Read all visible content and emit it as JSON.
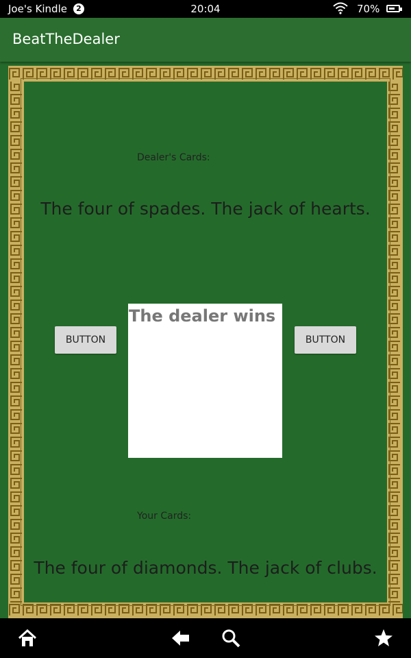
{
  "status_bar": {
    "device_name": "Joe's Kindle",
    "notification_count": "2",
    "time": "20:04",
    "battery_percent": "70%",
    "battery_level": 0.7
  },
  "app_bar": {
    "title": "BeatTheDealer"
  },
  "dealer": {
    "label": "Dealer's Cards:",
    "cards": "The four of spades. The jack of hearts."
  },
  "controls": {
    "left_button": "BUTTON",
    "right_button": "BUTTON"
  },
  "result": {
    "text": "The dealer wins"
  },
  "player": {
    "label": "Your Cards:",
    "cards": "The four of diamonds. The jack of clubs."
  },
  "nav_bar": {
    "icons": [
      "home-icon",
      "back-icon",
      "search-icon",
      "favorites-icon"
    ]
  },
  "colors": {
    "table_green": "#246b2b",
    "app_bar_green": "#2b6e2f",
    "border_gold": "#c9b060",
    "button_gray": "#d9d9d9"
  }
}
